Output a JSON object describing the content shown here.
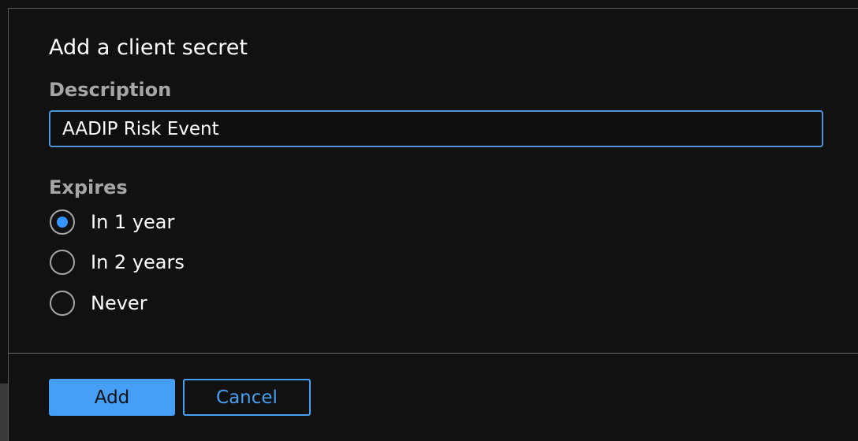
{
  "dialog": {
    "title": "Add a client secret",
    "description": {
      "label": "Description",
      "value": "AADIP Risk Event",
      "placeholder": ""
    },
    "expires": {
      "label": "Expires",
      "options": [
        {
          "label": "In 1 year",
          "checked": true
        },
        {
          "label": "In 2 years",
          "checked": false
        },
        {
          "label": "Never",
          "checked": false
        }
      ]
    },
    "footer": {
      "add_label": "Add",
      "cancel_label": "Cancel"
    }
  },
  "colors": {
    "background": "#111111",
    "accent": "#479ef5",
    "radio_selected": "#3794ff",
    "label_muted": "#a6a6a6"
  }
}
